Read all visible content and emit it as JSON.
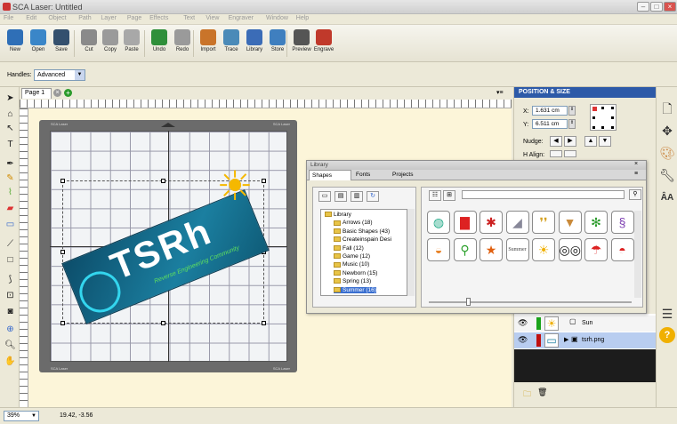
{
  "window": {
    "title": "SCA Laser: Untitled"
  },
  "menu": [
    "File",
    "Edit",
    "Object",
    "Path",
    "Layer",
    "Page",
    "Effects",
    "Text",
    "View",
    "Engraver",
    "Window",
    "Help"
  ],
  "toolbar": [
    {
      "label": "New",
      "icon": "new-document-icon",
      "color": "#2f6fb7"
    },
    {
      "label": "Open",
      "icon": "open-folder-icon",
      "color": "#3a86c8"
    },
    {
      "label": "Save",
      "icon": "save-disk-icon",
      "color": "#34506e"
    },
    {
      "label": "Cut",
      "icon": "scissors-icon",
      "color": "#8a8a8a"
    },
    {
      "label": "Copy",
      "icon": "copy-icon",
      "color": "#9a9a9a"
    },
    {
      "label": "Paste",
      "icon": "paste-icon",
      "color": "#a8a8a8"
    },
    {
      "label": "Undo",
      "icon": "undo-arrow-icon",
      "color": "#2f8f3a"
    },
    {
      "label": "Redo",
      "icon": "redo-arrow-icon",
      "color": "#9a9a9a"
    },
    {
      "label": "Import",
      "icon": "import-icon",
      "color": "#c9742a"
    },
    {
      "label": "Trace",
      "icon": "trace-icon",
      "color": "#4a8ab8"
    },
    {
      "label": "Library",
      "icon": "library-star-icon",
      "color": "#3b6cb7"
    },
    {
      "label": "Store",
      "icon": "store-cart-icon",
      "color": "#3f7fbf"
    },
    {
      "label": "Preview",
      "icon": "magnifier-icon",
      "color": "#555"
    },
    {
      "label": "Engrave",
      "icon": "laser-icon",
      "color": "#c0392b"
    }
  ],
  "handles": {
    "label": "Handles:",
    "value": "Advanced"
  },
  "page_tab": {
    "label": "Page 1"
  },
  "mat": {
    "tl": "SCA Laser",
    "tr": "SCA Laser",
    "bl": "SCA Laser",
    "br": "SCA Laser"
  },
  "artwork": {
    "logo_text": "TSRh",
    "logo_sub": "Reverse Engineering Community"
  },
  "position_size": {
    "title": "POSITION & SIZE",
    "x_label": "X:",
    "x_value": "1.631 cm",
    "y_label": "Y:",
    "y_value": "6.511 cm",
    "nudge_label": "Nudge:",
    "halign_label": "H Align:"
  },
  "layers": [
    {
      "name": "Sun",
      "color": "#1aa31a",
      "thumb": "☀"
    },
    {
      "name": "tsrh.png",
      "color": "#c01010",
      "thumb": "▭"
    }
  ],
  "library": {
    "title": "Library",
    "tabs": [
      "Shapes",
      "Fonts",
      "Projects"
    ],
    "tree": [
      "Library",
      "Arrows (18)",
      "Basic Shapes (43)",
      "Createinspain Desi",
      "Fall (12)",
      "Game (12)",
      "Music (10)",
      "Newborn (15)",
      "Spring (13)",
      "Summer (16)"
    ],
    "shapes": [
      {
        "name": "beach-ball-shape-icon",
        "glyph": "◍",
        "color": "#2a8"
      },
      {
        "name": "bucket-shape-icon",
        "glyph": "▇",
        "color": "#d22"
      },
      {
        "name": "crab-shape-icon",
        "glyph": "✱",
        "color": "#c22"
      },
      {
        "name": "dolphin-shape-icon",
        "glyph": "◢",
        "color": "#889"
      },
      {
        "name": "flip-flops-shape-icon",
        "glyph": "❜❜",
        "color": "#d4a020"
      },
      {
        "name": "ice-cream-shape-icon",
        "glyph": "▼",
        "color": "#c98a3a"
      },
      {
        "name": "palm-tree-shape-icon",
        "glyph": "✻",
        "color": "#2a9a2a"
      },
      {
        "name": "seahorse-shape-icon",
        "glyph": "§",
        "color": "#7a3bb0"
      },
      {
        "name": "shell-shape-icon",
        "glyph": "◒",
        "color": "#e8842a"
      },
      {
        "name": "shovel-shape-icon",
        "glyph": "⚲",
        "color": "#2aa02a"
      },
      {
        "name": "starfish-shape-icon",
        "glyph": "★",
        "color": "#e06010"
      },
      {
        "name": "summer-text-shape-icon",
        "glyph": "Summer",
        "color": "#444"
      },
      {
        "name": "sun-shape-icon",
        "glyph": "☀",
        "color": "#f0b000"
      },
      {
        "name": "sunglasses-shape-icon",
        "glyph": "◎◎",
        "color": "#111"
      },
      {
        "name": "umbrella-shape-icon",
        "glyph": "☂",
        "color": "#d22"
      },
      {
        "name": "watermelon-shape-icon",
        "glyph": "◓",
        "color": "#d22"
      }
    ]
  },
  "status": {
    "zoom": "39%",
    "coords": "19.42, -3.56"
  }
}
